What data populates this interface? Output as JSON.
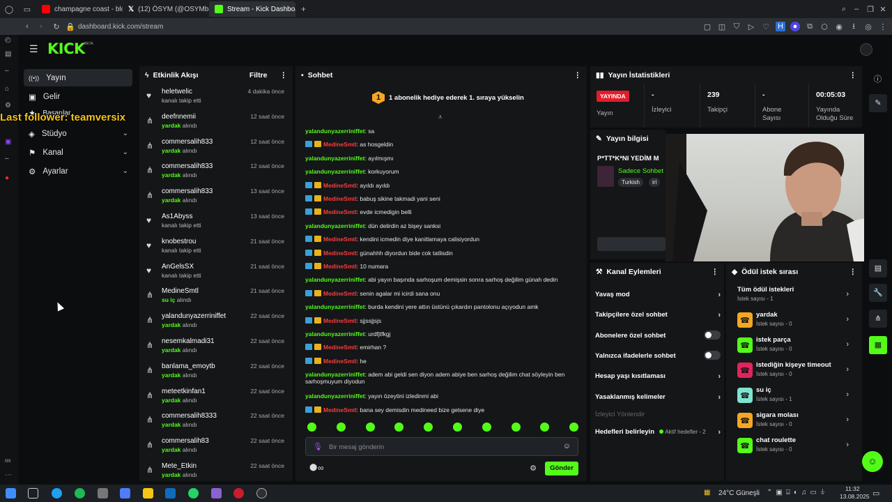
{
  "browser": {
    "tabs": [
      {
        "label": "champagne coast - blood",
        "color": "#ff0000"
      },
      {
        "label": "(12) ÖSYM (@OSYMbaşk",
        "color": "#ffffff"
      },
      {
        "label": "Stream - Kick Dashboard",
        "color": "#53fc18"
      }
    ],
    "new_tab": "+",
    "url": "dashboard.kick.com/stream"
  },
  "overlay": {
    "last_follower": "Last follower: teamversix"
  },
  "brand": {
    "logo": "KICK",
    "beta": "BETA",
    "accent": "#53fc18"
  },
  "sidebar": {
    "items": [
      {
        "label": "Yayın"
      },
      {
        "label": "Gelir"
      },
      {
        "label": "Başarılar"
      },
      {
        "label": "Stüdyo"
      },
      {
        "label": "Kanal"
      },
      {
        "label": "Ayarlar"
      }
    ]
  },
  "activity": {
    "title": "Etkinlik Akışı",
    "filter": "Filtre",
    "events": [
      {
        "name": "heletwelic",
        "sub": "kanalı takip etti",
        "time": "4 dakika önce",
        "icon": "heart-icon"
      },
      {
        "name": "deefnnemii",
        "sub_highlight": "yardak",
        "sub": "alındı",
        "time": "12 saat önce",
        "icon": "reward-icon"
      },
      {
        "name": "commersalih833",
        "sub_highlight": "yardak",
        "sub": "alındı",
        "time": "12 saat önce",
        "icon": "reward-icon"
      },
      {
        "name": "commersalih833",
        "sub_highlight": "yardak",
        "sub": "alındı",
        "time": "12 saat önce",
        "icon": "reward-icon"
      },
      {
        "name": "commersalih833",
        "sub_highlight": "yardak",
        "sub": "alındı",
        "time": "13 saat önce",
        "icon": "reward-icon"
      },
      {
        "name": "As1Abyss",
        "sub": "kanalı takip etti",
        "time": "13 saat önce",
        "icon": "heart-icon"
      },
      {
        "name": "knobestrou",
        "sub": "kanalı takip etti",
        "time": "21 saat önce",
        "icon": "heart-icon"
      },
      {
        "name": "AnGelsSX",
        "sub": "kanalı takip etti",
        "time": "21 saat önce",
        "icon": "heart-icon"
      },
      {
        "name": "MedineSmtl",
        "sub_highlight": "su iç",
        "sub": "alındı",
        "time": "21 saat önce",
        "icon": "reward-icon"
      },
      {
        "name": "yalandunyazerriniffet",
        "sub_highlight": "yardak",
        "sub": "alındı",
        "time": "22 saat önce",
        "icon": "reward-icon"
      },
      {
        "name": "nesemkalmadi31",
        "sub_highlight": "yardak",
        "sub": "alındı",
        "time": "22 saat önce",
        "icon": "reward-icon"
      },
      {
        "name": "banlama_emoytb",
        "sub_highlight": "yardak",
        "sub": "alındı",
        "time": "22 saat önce",
        "icon": "reward-icon"
      },
      {
        "name": "meteetkinfan1",
        "sub_highlight": "yardak",
        "sub": "alındı",
        "time": "22 saat önce",
        "icon": "reward-icon"
      },
      {
        "name": "commersalih8333",
        "sub_highlight": "yardak",
        "sub": "alındı",
        "time": "22 saat önce",
        "icon": "reward-icon"
      },
      {
        "name": "commersalih83",
        "sub_highlight": "yardak",
        "sub": "alındı",
        "time": "22 saat önce",
        "icon": "reward-icon"
      },
      {
        "name": "Mete_Etkin",
        "sub_highlight": "yardak",
        "sub": "alındı",
        "time": "22 saat önce",
        "icon": "reward-icon"
      }
    ]
  },
  "chat": {
    "title": "Sohbet",
    "pinned_number": "1",
    "pinned": "1 abonelik hediye ederek 1. sıraya yükselin",
    "messages": [
      {
        "user": "yalandunyazerriniffet",
        "text": ": sa",
        "mod": false
      },
      {
        "user": "MedineSmtl",
        "text": ": as hosgeldin",
        "mod": true
      },
      {
        "user": "yalandunyazerriniffet",
        "text": ": ayılmışmı",
        "mod": false
      },
      {
        "user": "yalandunyazerriniffet",
        "text": ": korkuyorum",
        "mod": false
      },
      {
        "user": "MedineSmtl",
        "text": ": ayıldı ayıldı",
        "mod": true
      },
      {
        "user": "MedineSmtl",
        "text": ": babuş sikine takmadi yani seni",
        "mod": true
      },
      {
        "user": "MedineSmtl",
        "text": ": evde icmedigin belli",
        "mod": true
      },
      {
        "user": "yalandunyazerriniffet",
        "text": ": dün delirdin az bişey sanksi",
        "mod": false
      },
      {
        "user": "MedineSmtl",
        "text": ": kendini icmedin diye kanitlamaya calisiyordun",
        "mod": true
      },
      {
        "user": "MedineSmtl",
        "text": ": günahhh diyordun bide cok tatlisdin",
        "mod": true
      },
      {
        "user": "MedineSmtl",
        "text": ": 10 numara",
        "mod": true
      },
      {
        "user": "yalandunyazerriniffet",
        "text": ": abi yayın başında sarhoşum demişsin sonra sarhoş değilim günah dedin",
        "mod": false
      },
      {
        "user": "MedineSmtl",
        "text": ": senin agalar mi icirdi sana onu",
        "mod": true
      },
      {
        "user": "yalandunyazerriniffet",
        "text": ": burda kendini yere attın üstünü çıkardın pantolonu açıyodun amk",
        "mod": false
      },
      {
        "user": "MedineSmtl",
        "text": ": sjjssjjsjs",
        "mod": true
      },
      {
        "user": "yalandunyazerriniffet",
        "text": ": urdfjtfkgj",
        "mod": false
      },
      {
        "user": "MedineSmtl",
        "text": ": emirhan ?",
        "mod": true
      },
      {
        "user": "MedineSmtl",
        "text": ": he",
        "mod": true
      },
      {
        "user": "yalandunyazerriniffet",
        "text": ": adem abi geldi sen diyon adem abiye ben sarhoş değilim chat söyleyin ben",
        "text2": "sarhoşmuyum diyodun",
        "mod": false
      },
      {
        "user": "yalandunyazerriniffet",
        "text": ": yayın özeytini izledinmi abi",
        "mod": false
      },
      {
        "user": "MedineSmtl",
        "text": ": bana sey demisdin medineed bize gelsene diye",
        "mod": true
      }
    ],
    "placeholder": "Bir mesaj gönderin",
    "send": "Gönder",
    "infinity": "∞"
  },
  "stats": {
    "title": "Yayın İstatistikleri",
    "live_badge": "YAYINDA",
    "items": [
      {
        "value": "",
        "label": "Yayın"
      },
      {
        "value": "-",
        "label": "İzleyici"
      },
      {
        "value": "239",
        "label": "Takipçi"
      },
      {
        "value": "-",
        "label": "Abone Sayısı"
      },
      {
        "value": "00:05:03",
        "label": "Yayında Olduğu Süre"
      }
    ]
  },
  "stream_info": {
    "title": "Yayın bilgisi",
    "stream_title": "P*TT*K*NI YEDİM M",
    "category": "Sadece Sohbet",
    "tags": [
      "Turkish",
      "irl"
    ]
  },
  "channel_actions": {
    "title": "Kanal Eylemleri",
    "items": [
      {
        "label": "Yavaş mod",
        "type": "arrow"
      },
      {
        "label": "Takipçilere özel sohbet",
        "type": "arrow"
      },
      {
        "label": "Abonelere özel sohbet",
        "type": "toggle"
      },
      {
        "label": "Yalnızca ifadelerle sohbet",
        "type": "toggle"
      },
      {
        "label": "Hesap yaşı kısıtlaması",
        "type": "arrow"
      },
      {
        "label": "Yasaklanmış kelimeler",
        "type": "arrow"
      }
    ],
    "section": "İzleyici Yönlendir",
    "goals": "Hedefleri belirleyin",
    "goals_status": "Aktif hedefler - 2"
  },
  "reward_queue": {
    "title": "Ödül istek sırası",
    "all": "Tüm ödül istekleri",
    "all_count": "İstek sayısı - 1",
    "items": [
      {
        "label": "yardak",
        "count": "İstek sayısı - 0",
        "color": "#f5a623"
      },
      {
        "label": "istek parça",
        "count": "İstek sayısı - 0",
        "color": "#53fc18"
      },
      {
        "label": "istediğin kişeye timeout",
        "count": "İstek sayısı - 0",
        "color": "#e0245e"
      },
      {
        "label": "su iç",
        "count": "İstek sayısı - 1",
        "color": "#7fe3d0"
      },
      {
        "label": "sigara molası",
        "count": "İstek sayısı - 0",
        "color": "#f5a623"
      },
      {
        "label": "chat roulette",
        "count": "İstek sayısı - 0",
        "color": "#53fc18"
      }
    ]
  },
  "taskbar": {
    "weather": "24°C Güneşli",
    "time": "11:32",
    "date": "13.08.2025"
  }
}
